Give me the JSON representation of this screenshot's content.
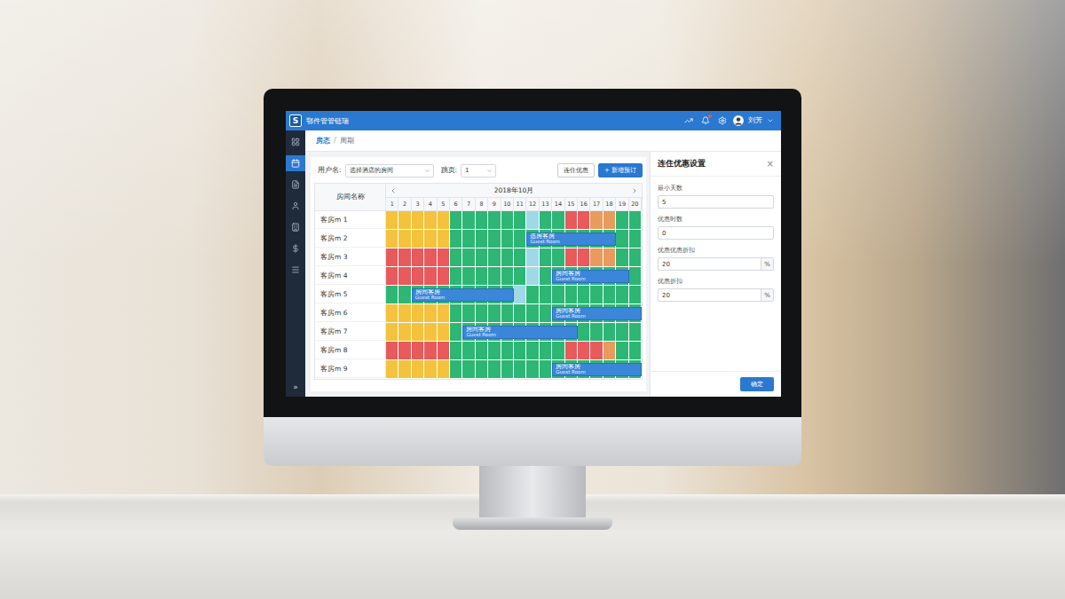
{
  "app": {
    "logo": "S",
    "title": "鄂件管管链瑞",
    "user": "刘芳"
  },
  "sidebar": {
    "items": [
      {
        "selected": false
      },
      {
        "selected": true
      },
      {
        "selected": false
      },
      {
        "selected": false
      },
      {
        "selected": false
      },
      {
        "selected": false
      },
      {
        "selected": false
      }
    ],
    "collapse": "»"
  },
  "breadcrumb": {
    "items": [
      "房态",
      "周期"
    ],
    "separator": "/"
  },
  "filters": [
    {
      "label": "用户名:",
      "value": "选择酒店的房间"
    },
    {
      "label": "跳页:",
      "value": "1"
    }
  ],
  "buttons": [
    {
      "label": "连住优惠",
      "kind": "outline"
    },
    {
      "label": "+ 新增预订",
      "kind": "primary"
    }
  ],
  "calendar": {
    "name_header": "房间名称",
    "month": "2018年10月",
    "days": [
      "1",
      "2",
      "3",
      "4",
      "5",
      "6",
      "7",
      "8",
      "9",
      "10",
      "11",
      "12",
      "13",
      "14",
      "15",
      "16",
      "17",
      "18",
      "19",
      "20"
    ],
    "rows": [
      {
        "name": "客房m 1",
        "cells": [
          "#f4c23d",
          "#f4c23d",
          "#f4c23d",
          "#f4c23d",
          "#f4c23d",
          "#2db674",
          "#2db674",
          "#2db674",
          "#2db674",
          "#2db674",
          "#2db674",
          "#9fd8e6",
          "#2db674",
          "#2db674",
          "#e85a5c",
          "#e85a5c",
          "#e99a5d",
          "#e99a5d",
          "#2db674",
          "#2db674"
        ],
        "bookings": []
      },
      {
        "name": "客房m 2",
        "cells": [
          "#f4c23d",
          "#f4c23d",
          "#f4c23d",
          "#f4c23d",
          "#f4c23d",
          "#2db674",
          "#2db674",
          "#2db674",
          "#2db674",
          "#2db674",
          "#2db674",
          "#2db674",
          "#2db674",
          "#2db674",
          "#2db674",
          "#2db674",
          "#2db674",
          "#2db674",
          "#2db674",
          "#2db674"
        ],
        "bookings": [
          {
            "start": 12,
            "span": 7,
            "title": "选房客房",
            "subtitle": "Guest Room"
          }
        ]
      },
      {
        "name": "客房m 3",
        "cells": [
          "#e85a5c",
          "#e85a5c",
          "#e85a5c",
          "#e85a5c",
          "#e85a5c",
          "#2db674",
          "#2db674",
          "#2db674",
          "#2db674",
          "#2db674",
          "#2db674",
          "#9fd8e6",
          "#2db674",
          "#2db674",
          "#e85a5c",
          "#e85a5c",
          "#e99a5d",
          "#e99a5d",
          "#2db674",
          "#2db674"
        ],
        "bookings": []
      },
      {
        "name": "客房m 4",
        "cells": [
          "#e85a5c",
          "#e85a5c",
          "#e85a5c",
          "#e85a5c",
          "#e85a5c",
          "#2db674",
          "#2db674",
          "#2db674",
          "#2db674",
          "#2db674",
          "#2db674",
          "#9fd8e6",
          "#2db674",
          "#2db674",
          "#2db674",
          "#2db674",
          "#2db674",
          "#2db674",
          "#2db674",
          "#2db674"
        ],
        "bookings": [
          {
            "start": 14,
            "span": 6,
            "title": "房间客房",
            "subtitle": "Guest Room"
          }
        ]
      },
      {
        "name": "客房m 5",
        "cells": [
          "#2db674",
          "#2db674",
          "#2db674",
          "#2db674",
          "#2db674",
          "#2db674",
          "#2db674",
          "#2db674",
          "#2db674",
          "#2db674",
          "#9fd8e6",
          "#2db674",
          "#2db674",
          "#2db674",
          "#2db674",
          "#2db674",
          "#2db674",
          "#2db674",
          "#2db674",
          "#2db674"
        ],
        "bookings": [
          {
            "start": 3,
            "span": 8,
            "title": "房间客房",
            "subtitle": "Guest Room"
          }
        ]
      },
      {
        "name": "客房m 6",
        "cells": [
          "#f4c23d",
          "#f4c23d",
          "#f4c23d",
          "#f4c23d",
          "#f4c23d",
          "#2db674",
          "#2db674",
          "#2db674",
          "#2db674",
          "#2db674",
          "#2db674",
          "#2db674",
          "#2db674",
          "#2db674",
          "#2db674",
          "#2db674",
          "#2db674",
          "#2db674",
          "#2db674",
          "#2db674"
        ],
        "bookings": [
          {
            "start": 14,
            "span": 7,
            "title": "房间客房",
            "subtitle": "Guest Room"
          }
        ]
      },
      {
        "name": "客房m 7",
        "cells": [
          "#f4c23d",
          "#f4c23d",
          "#f4c23d",
          "#f4c23d",
          "#f4c23d",
          "#2db674",
          "#2db674",
          "#2db674",
          "#2db674",
          "#2db674",
          "#2db674",
          "#2db674",
          "#2db674",
          "#2db674",
          "#2db674",
          "#2db674",
          "#2db674",
          "#2db674",
          "#2db674",
          "#2db674"
        ],
        "bookings": [
          {
            "start": 7,
            "span": 9,
            "title": "房间客房",
            "subtitle": "Guest Room"
          }
        ]
      },
      {
        "name": "客房m 8",
        "cells": [
          "#e85a5c",
          "#e85a5c",
          "#e85a5c",
          "#e85a5c",
          "#e85a5c",
          "#2db674",
          "#2db674",
          "#2db674",
          "#2db674",
          "#2db674",
          "#2db674",
          "#2db674",
          "#2db674",
          "#2db674",
          "#e85a5c",
          "#e85a5c",
          "#e85a5c",
          "#e99a5d",
          "#2db674",
          "#2db674"
        ],
        "bookings": []
      },
      {
        "name": "客房m 9",
        "cells": [
          "#f4c23d",
          "#f4c23d",
          "#f4c23d",
          "#f4c23d",
          "#f4c23d",
          "#2db674",
          "#2db674",
          "#2db674",
          "#2db674",
          "#2db674",
          "#2db674",
          "#2db674",
          "#2db674",
          "#2db674",
          "#2db674",
          "#2db674",
          "#2db674",
          "#2db674",
          "#2db674",
          "#2db674"
        ],
        "bookings": [
          {
            "start": 14,
            "span": 7,
            "title": "房间客房",
            "subtitle": "Guest Room"
          }
        ]
      }
    ]
  },
  "panel": {
    "title": "连住优惠设置",
    "close": "×",
    "fields": [
      {
        "label": "最小天数",
        "value": "5"
      },
      {
        "label": "优惠时数",
        "value": "0"
      },
      {
        "label": "优惠优惠折扣",
        "value": "20",
        "unit": "%"
      },
      {
        "label": "优惠折扣",
        "value": "20",
        "unit": "%"
      }
    ],
    "submit": "确定"
  }
}
